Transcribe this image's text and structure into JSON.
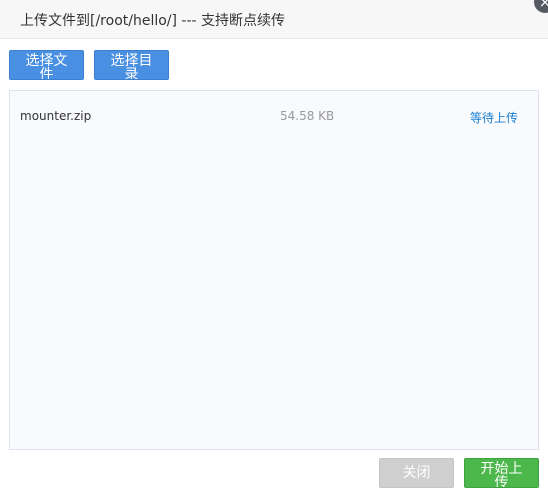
{
  "dialog": {
    "title": "上传文件到[/root/hello/] --- 支持断点续传",
    "close_icon": "×"
  },
  "toolbar": {
    "select_files_label": "选择文件",
    "select_directory_label": "选择目录"
  },
  "files": [
    {
      "name": "mounter.zip",
      "size": "54.58 KB",
      "status": "等待上传"
    }
  ],
  "footer": {
    "close_label": "关闭",
    "start_upload_label": "开始上传"
  },
  "colors": {
    "primary_button": "#4a90e2",
    "success_button": "#4cb84c",
    "disabled_button": "#cfcfcf",
    "status_link": "#1a7fd1"
  }
}
